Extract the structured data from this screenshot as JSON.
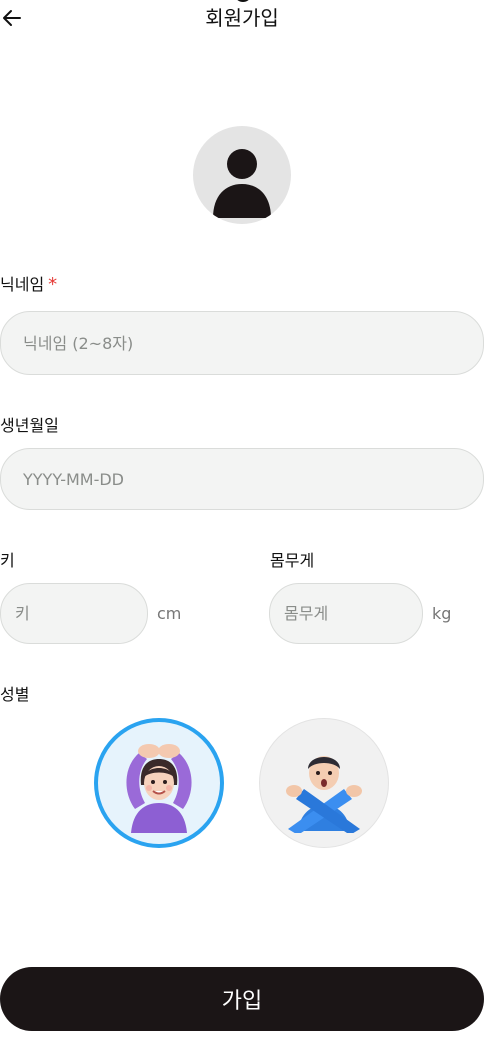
{
  "header": {
    "title": "회원가입",
    "back_icon": "arrow-left-icon"
  },
  "profile": {
    "avatar_icon": "person-icon"
  },
  "nickname": {
    "label": "닉네임",
    "required_mark": "*",
    "placeholder": "닉네임 (2~8자)",
    "value": ""
  },
  "birthdate": {
    "label": "생년월일",
    "placeholder": "YYYY-MM-DD",
    "value": ""
  },
  "height": {
    "label": "키",
    "placeholder": "키",
    "value": "",
    "unit": "cm"
  },
  "weight": {
    "label": "몸무게",
    "placeholder": "몸무게",
    "value": "",
    "unit": "kg"
  },
  "gender": {
    "label": "성별",
    "options": [
      {
        "icon": "woman-ok-gesture-icon",
        "selected": true
      },
      {
        "icon": "man-no-gesture-icon",
        "selected": false
      }
    ],
    "selected_color": "#2aa3f0"
  },
  "submit": {
    "label": "가입",
    "color": "#1b1516"
  }
}
